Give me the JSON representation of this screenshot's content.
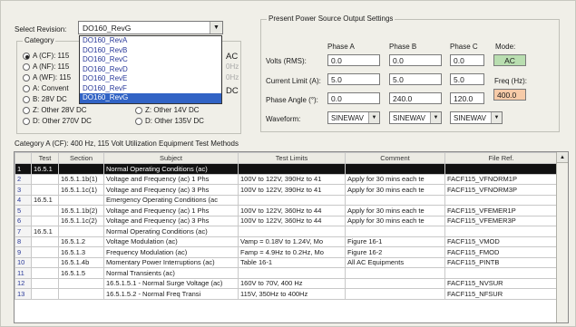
{
  "revision": {
    "label": "Select Revision:",
    "selected": "DO160_RevG",
    "options": [
      "DO160_RevA",
      "DO160_RevB",
      "DO160_RevC",
      "DO160_RevD",
      "DO160_RevE",
      "DO160_RevF",
      "DO160_RevG"
    ]
  },
  "category": {
    "title": "Category",
    "left": [
      {
        "label": "A (CF): 115",
        "checked": true
      },
      {
        "label": "A (NF): 115",
        "checked": false
      },
      {
        "label": "A (WF): 115",
        "checked": false
      },
      {
        "label": "A: Convent",
        "checked": false
      },
      {
        "label": "B: 28V DC",
        "checked": false
      },
      {
        "label": "Z: Other 28V DC",
        "checked": false
      },
      {
        "label": "D: Other 270V DC",
        "checked": false
      }
    ],
    "right": [
      {
        "label": "AC",
        "checked": false
      },
      {
        "label": "0Hz",
        "checked": false
      },
      {
        "label": "0Hz",
        "checked": false
      },
      {
        "label": "DC",
        "checked": false
      },
      {
        "label": "Z: Other 14V DC",
        "checked": false
      },
      {
        "label": "D: Other 135V DC",
        "checked": false
      }
    ]
  },
  "power": {
    "title": "Present Power Source Output Settings",
    "phase_a": "Phase A",
    "phase_b": "Phase B",
    "phase_c": "Phase C",
    "mode_label": "Mode:",
    "volts_label": "Volts (RMS):",
    "current_label": "Current Limit (A):",
    "angle_label": "Phase Angle (°):",
    "waveform_label": "Waveform:",
    "freq_label": "Freq (Hz):",
    "volts": [
      "0.0",
      "0.0",
      "0.0"
    ],
    "current": [
      "5.0",
      "5.0",
      "5.0"
    ],
    "angle": [
      "0.0",
      "240.0",
      "120.0"
    ],
    "waveform": [
      "SINEWAV",
      "SINEWAV",
      "SINEWAV"
    ],
    "mode": "AC",
    "freq": "400.0",
    "colors": {
      "mode_bg": "#b9deb0",
      "freq_bg": "#f7cba8"
    }
  },
  "table": {
    "caption": "Category A (CF): 400 Hz, 115 Volt Utilization Equipment Test Methods",
    "headers": [
      "",
      "Test",
      "Section",
      "Subject",
      "Test Limits",
      "Comment",
      "File Ref."
    ],
    "rows": [
      [
        "1",
        "16.5.1",
        "",
        "Normal Operating Conditions (ac)",
        "",
        "",
        ""
      ],
      [
        "2",
        "",
        "16.5.1.1b(1)",
        "Voltage and Frequency (ac) 1 Phs",
        "100V to 122V, 390Hz to 41",
        "Apply for 30 mins each te",
        "FACF115_VFNORM1P"
      ],
      [
        "3",
        "",
        "16.5.1.1c(1)",
        "Voltage and Frequency (ac) 3 Phs",
        "100V to 122V, 390Hz to 41",
        "Apply for 30 mins each te",
        "FACF115_VFNORM3P"
      ],
      [
        "4",
        "16.5.1",
        "",
        "Emergency Operating Conditions (ac",
        "",
        "",
        ""
      ],
      [
        "5",
        "",
        "16.5.1.1b(2)",
        "Voltage and Frequency (ac) 1 Phs",
        "100V to 122V, 360Hz to 44",
        "Apply for 30 mins each te",
        "FACF115_VFEMER1P"
      ],
      [
        "6",
        "",
        "16.5.1.1c(2)",
        "Voltage and Frequency (ac) 3 Phs",
        "100V to 122V, 360Hz to 44",
        "Apply for 30 mins each te",
        "FACF115_VFEMER3P"
      ],
      [
        "7",
        "16.5.1",
        "",
        "Normal Operating Conditions (ac)",
        "",
        "",
        ""
      ],
      [
        "8",
        "",
        "16.5.1.2",
        "Voltage Modulation (ac)",
        "Vamp = 0.18V to 1.24V, Mo",
        "Figure 16-1",
        "FACF115_VMOD"
      ],
      [
        "9",
        "",
        "16.5.1.3",
        "Frequency Modulation (ac)",
        "Famp = 4.9Hz to 0.2Hz, Mo",
        "Figure 16-2",
        "FACF115_FMOD"
      ],
      [
        "10",
        "",
        "16.5.1.4b",
        "Momentary Power Interruptions (ac)",
        "Table 16-1",
        "All AC Equipments",
        "FACF115_PINTB"
      ],
      [
        "11",
        "",
        "16.5.1.5",
        "Normal Transients (ac)",
        "",
        "",
        ""
      ],
      [
        "12",
        "",
        "",
        "16.5.1.5.1 - Normal Surge Voltage (ac)",
        "160V to 70V, 400 Hz",
        "",
        "FACF115_NVSUR"
      ],
      [
        "13",
        "",
        "",
        "16.5.1.5.2 - Normal Freq Transi",
        "115V, 350Hz to 400Hz",
        "",
        "FACF115_NFSUR"
      ]
    ],
    "selected_row": 0
  }
}
